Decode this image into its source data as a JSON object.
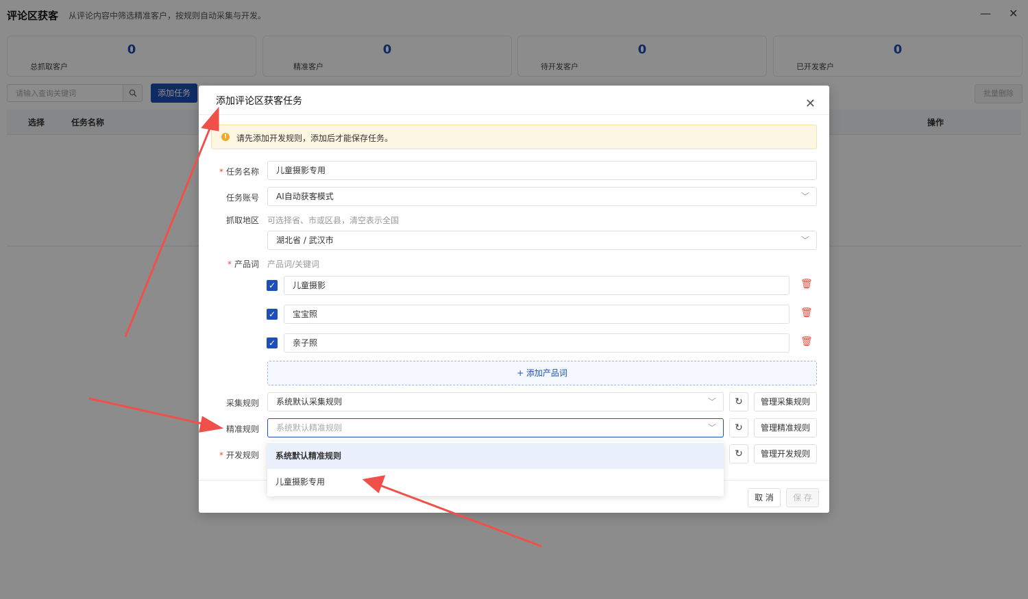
{
  "app": {
    "title": "评论区获客",
    "subtitle": "从评论内容中筛选精准客户，按规则自动采集与开发。",
    "minimize_icon": "minimize-icon",
    "close_icon": "close-icon"
  },
  "stats": [
    {
      "value": "0",
      "label": "总抓取客户"
    },
    {
      "value": "0",
      "label": "精准客户"
    },
    {
      "value": "0",
      "label": "待开发客户"
    },
    {
      "value": "0",
      "label": "已开发客户"
    }
  ],
  "toolbar": {
    "search_placeholder": "请输入查询关键词",
    "add_task": "添加任务",
    "batch_delete": "批量删除"
  },
  "table": {
    "headers": [
      "选择",
      "任务名称",
      "操作"
    ]
  },
  "dialog": {
    "title": "添加评论区获客任务",
    "alert": "请先添加开发规则，添加后才能保存任务。",
    "task_name_label": "任务名称",
    "task_name_value": "儿童摄影专用",
    "account_label": "任务账号",
    "account_value": "AI自动获客模式",
    "region_label": "抓取地区",
    "region_hint": "可选择省、市或区县，清空表示全国",
    "region_value": "湖北省 / 武汉市",
    "product_label": "产品词",
    "product_hint": "产品词/关键词",
    "products": [
      {
        "checked": true,
        "value": "儿童摄影"
      },
      {
        "checked": true,
        "value": "宝宝照"
      },
      {
        "checked": true,
        "value": "亲子照"
      }
    ],
    "add_product": "+ 添加产品词",
    "collect_rule_label": "采集规则",
    "collect_rule_value": "系统默认采集规则",
    "manage_collect": "管理采集规则",
    "precise_rule_label": "精准规则",
    "precise_rule_placeholder": "系统默认精准规则",
    "manage_precise": "管理精准规则",
    "develop_rule_label": "开发规则",
    "manage_develop": "管理开发规则",
    "cancel": "取 消",
    "save": "保 存"
  },
  "dropdown": {
    "options": [
      "系统默认精准规则",
      "儿童摄影专用"
    ],
    "selected_index": 0
  },
  "colors": {
    "primary": "#1e4fb6",
    "danger": "#e74c3c",
    "warning_bg": "#fdf6e2",
    "annotation_arrow": "#f0504a"
  }
}
